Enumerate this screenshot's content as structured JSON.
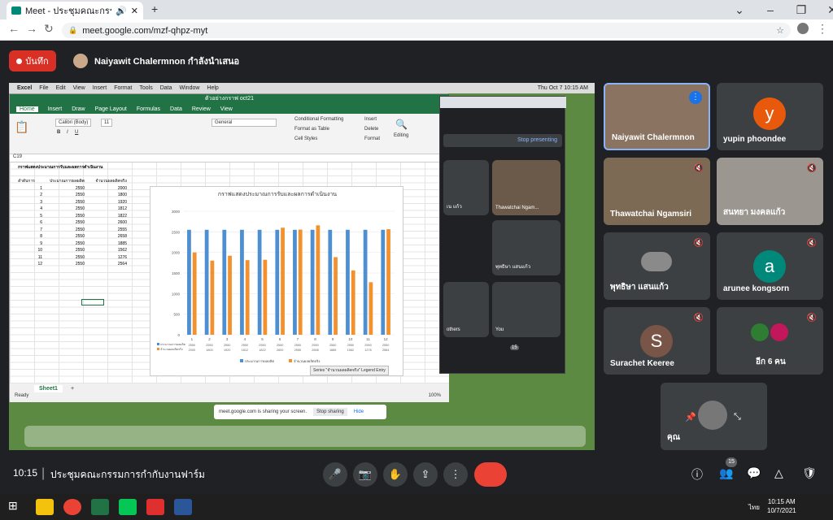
{
  "browser": {
    "tab_title": "Meet - ประชุมคณะกรรมการกำกั",
    "url": "meet.google.com/mzf-qhpz-myt",
    "new_tab": "+"
  },
  "meet": {
    "record_label": "บันทึก",
    "presenting_text": "Naiyawit Chalermnon กำลังนำเสนอ",
    "time": "10:15",
    "meeting_title": "ประชุมคณะกรรมการกำกับงานฟาร์ม",
    "participants_count": "15",
    "tiles": [
      {
        "name": "Naiyawit Chalermnon",
        "type": "video"
      },
      {
        "name": "yupin phoondee",
        "initial": "y",
        "color": "#e8590c"
      },
      {
        "name": "Thawatchai Ngamsiri",
        "type": "video"
      },
      {
        "name": "สนทยา มงคลแก้ว",
        "type": "video"
      },
      {
        "name": "พุทธิษา แสนแก้ว",
        "type": "video"
      },
      {
        "name": "arunee kongsorn",
        "initial": "a",
        "color": "#00897b"
      },
      {
        "name": "Surachet Keeree",
        "initial": "S",
        "color": "#795548"
      },
      {
        "name": "อีก 6 คน"
      },
      {
        "name": "คุณ"
      }
    ]
  },
  "excel": {
    "menu": [
      "Excel",
      "File",
      "Edit",
      "View",
      "Insert",
      "Format",
      "Tools",
      "Data",
      "Window",
      "Help"
    ],
    "file_title": "ตัวอย่างกราฟ oct21",
    "tabs": [
      "Home",
      "Insert",
      "Draw",
      "Page Layout",
      "Formulas",
      "Data",
      "Review",
      "View"
    ],
    "font": "Calibri (Body)",
    "font_size": "11",
    "number_format": "General",
    "styles": [
      "Conditional Formatting",
      "Format as Table",
      "Cell Styles"
    ],
    "cells_group": [
      "Insert",
      "Delete",
      "Format"
    ],
    "editing": "Editing",
    "name_box": "C19",
    "sheet_title": "กราฟแสดงประมาณการรับและผลการดำเนินงาน",
    "headers": [
      "ลำดับการ",
      "ประมาณการผลผลิต",
      "จำนวนผลผลิตจริง"
    ],
    "rows": [
      [
        "1",
        "2550",
        "2000"
      ],
      [
        "2",
        "2550",
        "1800"
      ],
      [
        "3",
        "2550",
        "1920"
      ],
      [
        "4",
        "2550",
        "1812"
      ],
      [
        "5",
        "2550",
        "1822"
      ],
      [
        "6",
        "2550",
        "2600"
      ],
      [
        "7",
        "2550",
        "2555"
      ],
      [
        "8",
        "2550",
        "2658"
      ],
      [
        "9",
        "2550",
        "1885"
      ],
      [
        "10",
        "2550",
        "1562"
      ],
      [
        "11",
        "2550",
        "1276"
      ],
      [
        "12",
        "2550",
        "2564"
      ]
    ],
    "sheet_tab": "Sheet1",
    "status": "Ready",
    "zoom": "100%",
    "series_tip": "Series \"จำนวนผลผลิตจริง\" Legend Entry"
  },
  "chart_data": {
    "type": "bar",
    "title": "กราฟแสดงประมาณการรับและผลการดำเนินงาน",
    "categories": [
      "1",
      "2",
      "3",
      "4",
      "5",
      "6",
      "7",
      "8",
      "9",
      "10",
      "11",
      "12"
    ],
    "series": [
      {
        "name": "ประมาณการผลผลิต",
        "values": [
          2550,
          2550,
          2550,
          2550,
          2550,
          2550,
          2550,
          2550,
          2550,
          2550,
          2550,
          2550
        ],
        "color": "#4e8fd1"
      },
      {
        "name": "จำนวนผลผลิตจริง",
        "values": [
          2000,
          1800,
          1920,
          1812,
          1822,
          2600,
          2555,
          2658,
          1885,
          1562,
          1276,
          2564
        ],
        "color": "#f2912d"
      }
    ],
    "ylim": [
      0,
      3000
    ],
    "yticks": [
      0,
      500,
      1000,
      1500,
      2000,
      2500,
      3000
    ]
  },
  "share_notice": {
    "text": "meet.google.com is sharing your screen.",
    "stop": "Stop sharing",
    "hide": "Hide"
  },
  "mini_meet": {
    "stop_presenting": "Stop presenting",
    "labels": [
      "Thawatchai Ngam...",
      "พุทธิษา แสนแก้ว",
      "You",
      "เน แก้ว",
      "others"
    ],
    "count": "15"
  },
  "mac": {
    "clock": "Thu Oct 7  10:15 AM"
  },
  "taskbar": {
    "time": "10:15 AM",
    "date": "10/7/2021",
    "lang": "ไทย"
  }
}
